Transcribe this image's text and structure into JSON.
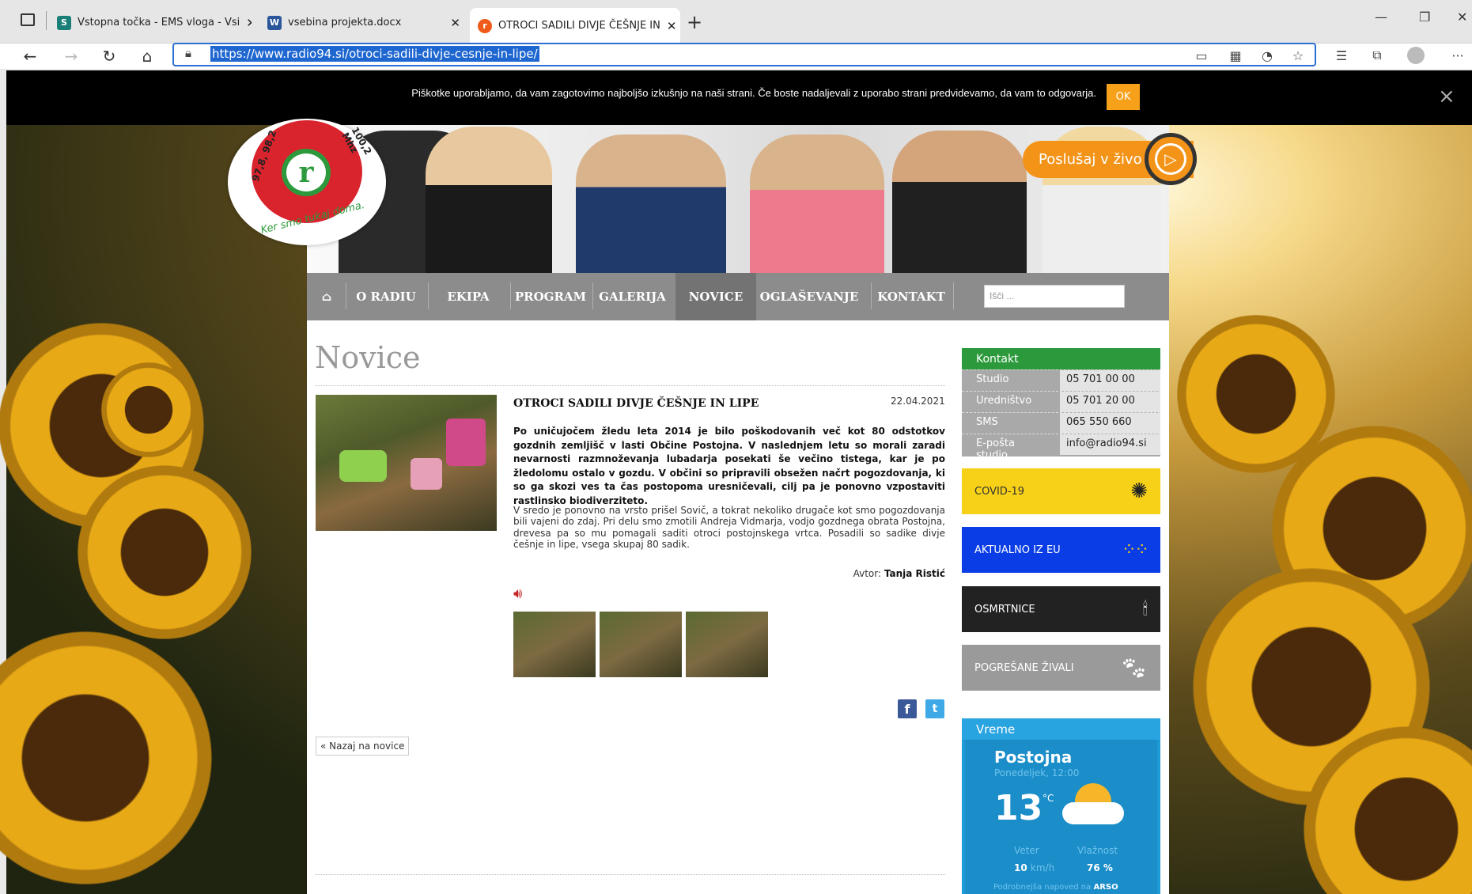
{
  "browser": {
    "tabs": [
      {
        "title": "Vstopna točka - EMS vloga - Vsi",
        "icon": "sharepoint-icon",
        "color": "#1b7f79"
      },
      {
        "title": "vsebina projekta.docx",
        "icon": "word-icon",
        "color": "#2b579a"
      },
      {
        "title": "OTROCI SADILI DIVJE ČEŠNJE IN",
        "icon": "radio94-icon",
        "color": "#d9232d"
      }
    ],
    "new_tab": "+",
    "url": "https://www.radio94.si/otroci-sadili-divje-cesnje-in-lipe/"
  },
  "cookie": {
    "text": "Piškotke uporabljamo, da vam zagotovimo najboljšo izkušnjo na naši strani. Če boste nadaljevali z uporabo strani predvidevamo, da vam to odgovarja.",
    "ok": "OK",
    "close": "×"
  },
  "logo": {
    "letter": "r",
    "freq": "97,8, 98,2",
    "freq2": "100,2 Mhz",
    "slogan": "Ker smo tukaj doma."
  },
  "listen": {
    "label": "Poslušaj v živo"
  },
  "nav": {
    "items": [
      "O RADIU",
      "EKIPA",
      "PROGRAM",
      "GALERIJA",
      "NOVICE",
      "OGLAŠEVANJE",
      "KONTAKT"
    ],
    "active": "NOVICE",
    "search_placeholder": "Išči ..."
  },
  "page": {
    "heading": "Novice"
  },
  "article": {
    "title": "OTROCI SADILI DIVJE ČEŠNJE IN LIPE",
    "date": "22.04.2021",
    "lead": "Po uničujočem žledu leta 2014 je bilo poškodovanih več kot 80 odstotkov gozdnih zemljišč v lasti Občine Postojna. V naslednjem letu so morali zaradi nevarnosti razmnoževanja lubadarja posekati še večino tistega, kar je po žledolomu ostalo v gozdu. V občini so pripravili obsežen načrt pogozdovanja, ki so ga skozi ves ta čas postopoma uresničevali, cilj pa je ponovno vzpostaviti rastlinsko biodiverziteto.",
    "body": "V sredo je ponovno na vrsto prišel Sovič, a tokrat nekoliko drugače kot smo pogozdovanja bili vajeni do zdaj. Pri delu smo zmotili Andreja Vidmarja, vodjo gozdnega obrata Postojna, drevesa pa so mu pomagali saditi otroci postojnskega vrtca. Posadili so sadike divje češnje in lipe, vsega skupaj 80 sadik.",
    "author_label": "Avtor:",
    "author": "Tanja Ristić",
    "back": "« Nazaj na novice"
  },
  "sidebar": {
    "kontakt_title": "Kontakt",
    "kontakt": [
      {
        "k": "Studio",
        "v": "05 701 00 00"
      },
      {
        "k": "Uredništvo",
        "v": "05 701 20 00"
      },
      {
        "k": "SMS",
        "v": "065 550 660"
      },
      {
        "k": "E-pošta studio",
        "v": "info@radio94.si"
      }
    ],
    "buttons": [
      {
        "label": "COVID-19",
        "color": "#f7d117",
        "text_color": "#333",
        "icon": "virus-icon"
      },
      {
        "label": "AKTUALNO IZ EU",
        "color": "#0a3de6",
        "text_color": "#fff",
        "icon": "eu-stars-icon"
      },
      {
        "label": "OSMRTNICE",
        "color": "#222222",
        "text_color": "#fff",
        "icon": "candle-icon"
      },
      {
        "label": "POGREŠANE ŽIVALI",
        "color": "#9a9a9a",
        "text_color": "#fff",
        "icon": "paw-icon"
      }
    ],
    "weather": {
      "title": "Vreme",
      "city": "Postojna",
      "time": "Ponedeljek, 12:00",
      "temp": "13",
      "unit": "°C",
      "wind_label": "Veter",
      "wind": "10",
      "wind_unit": "km/h",
      "hum_label": "Vlažnost",
      "hum": "76 %",
      "more": "Podrobnejša napoved na",
      "source": "ARSO"
    }
  }
}
